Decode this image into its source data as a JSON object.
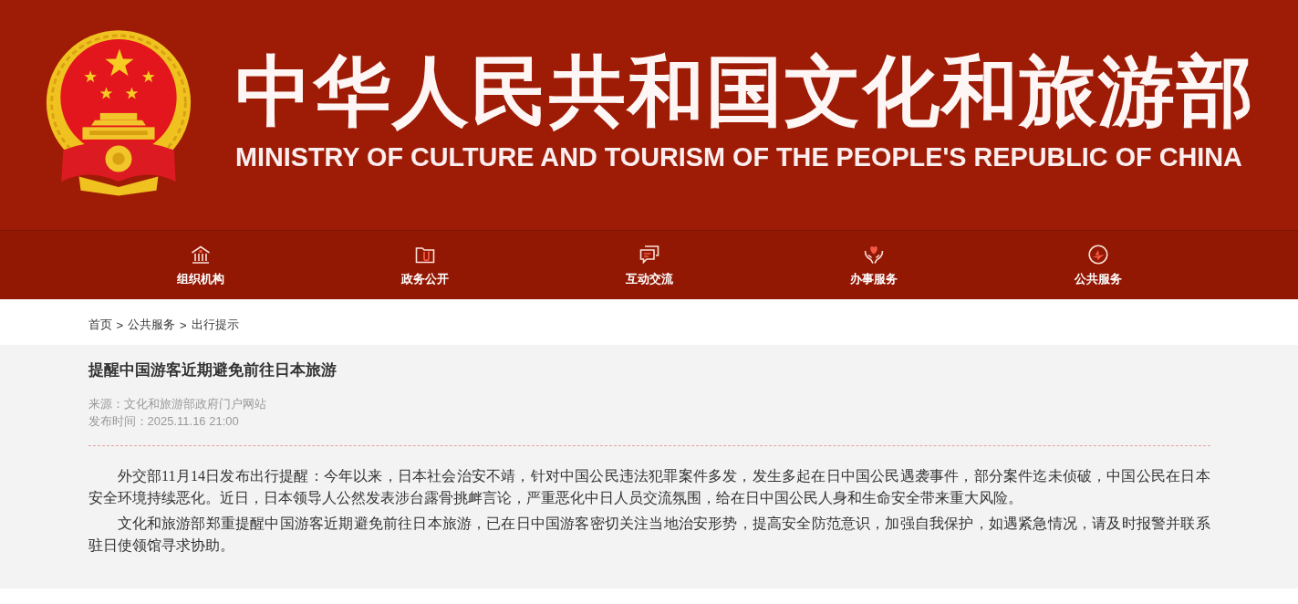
{
  "header": {
    "title": "中华人民共和国文化和旅游部",
    "subtitle": "MINISTRY OF CULTURE AND TOURISM OF THE PEOPLE'S REPUBLIC OF CHINA"
  },
  "nav": {
    "items": [
      {
        "label": "组织机构"
      },
      {
        "label": "政务公开"
      },
      {
        "label": "互动交流"
      },
      {
        "label": "办事服务"
      },
      {
        "label": "公共服务"
      }
    ]
  },
  "breadcrumb": {
    "items": [
      "首页",
      "公共服务",
      "出行提示"
    ],
    "separators": [
      ">",
      ">"
    ]
  },
  "article": {
    "title": "提醒中国游客近期避免前往日本旅游",
    "source": "来源：文化和旅游部政府门户网站",
    "published": "发布时间：2025.11.16 21:00",
    "paragraphs": [
      "外交部11月14日发布出行提醒：今年以来，日本社会治安不靖，针对中国公民违法犯罪案件多发，发生多起在日中国公民遇袭事件，部分案件迄未侦破，中国公民在日本安全环境持续恶化。近日，日本领导人公然发表涉台露骨挑衅言论，严重恶化中日人员交流氛围，给在日中国公民人身和生命安全带来重大风险。",
      "文化和旅游部郑重提醒中国游客近期避免前往日本旅游，已在日中国游客密切关注当地治安形势，提高安全防范意识，加强自我保护，如遇紧急情况，请及时报警并联系驻日使领馆寻求协助。"
    ]
  }
}
